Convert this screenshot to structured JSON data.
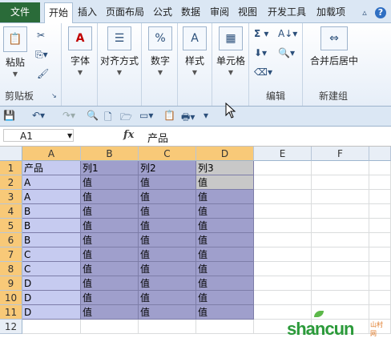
{
  "tabs": [
    "文件",
    "开始",
    "插入",
    "页面布局",
    "公式",
    "数据",
    "审阅",
    "视图",
    "开发工具",
    "加载项"
  ],
  "active_tab": "开始",
  "ribbon": {
    "clipboard": {
      "paste": "粘贴",
      "label": "剪贴板"
    },
    "font": "字体",
    "align": "对齐方式",
    "number": "数字",
    "styles": "样式",
    "cells": "单元格",
    "edit_label": "编辑",
    "merge": "合并后居中",
    "new_group": "新建组"
  },
  "formula_bar": {
    "name_box": "A1",
    "fx": "fx",
    "content": "产品"
  },
  "columns": [
    "A",
    "B",
    "C",
    "D",
    "E",
    "F"
  ],
  "rows": [
    "1",
    "2",
    "3",
    "4",
    "5",
    "6",
    "7",
    "8",
    "9",
    "10",
    "11",
    "12"
  ],
  "table": {
    "headers": [
      "产品",
      "列1",
      "列2",
      "列3"
    ],
    "col_a": [
      "A",
      "A",
      "B",
      "B",
      "B",
      "C",
      "C",
      "D",
      "D",
      "D"
    ],
    "value": "值"
  },
  "watermark": {
    "text": "shancun",
    "sub": "山村网"
  },
  "colors": {
    "file_tab": "#2a6b39",
    "selection_a": "#c6cbf0",
    "selection_other": "#9f9fcc",
    "header_highlight": "#f8c978",
    "watermark": "#2b9a3a"
  }
}
